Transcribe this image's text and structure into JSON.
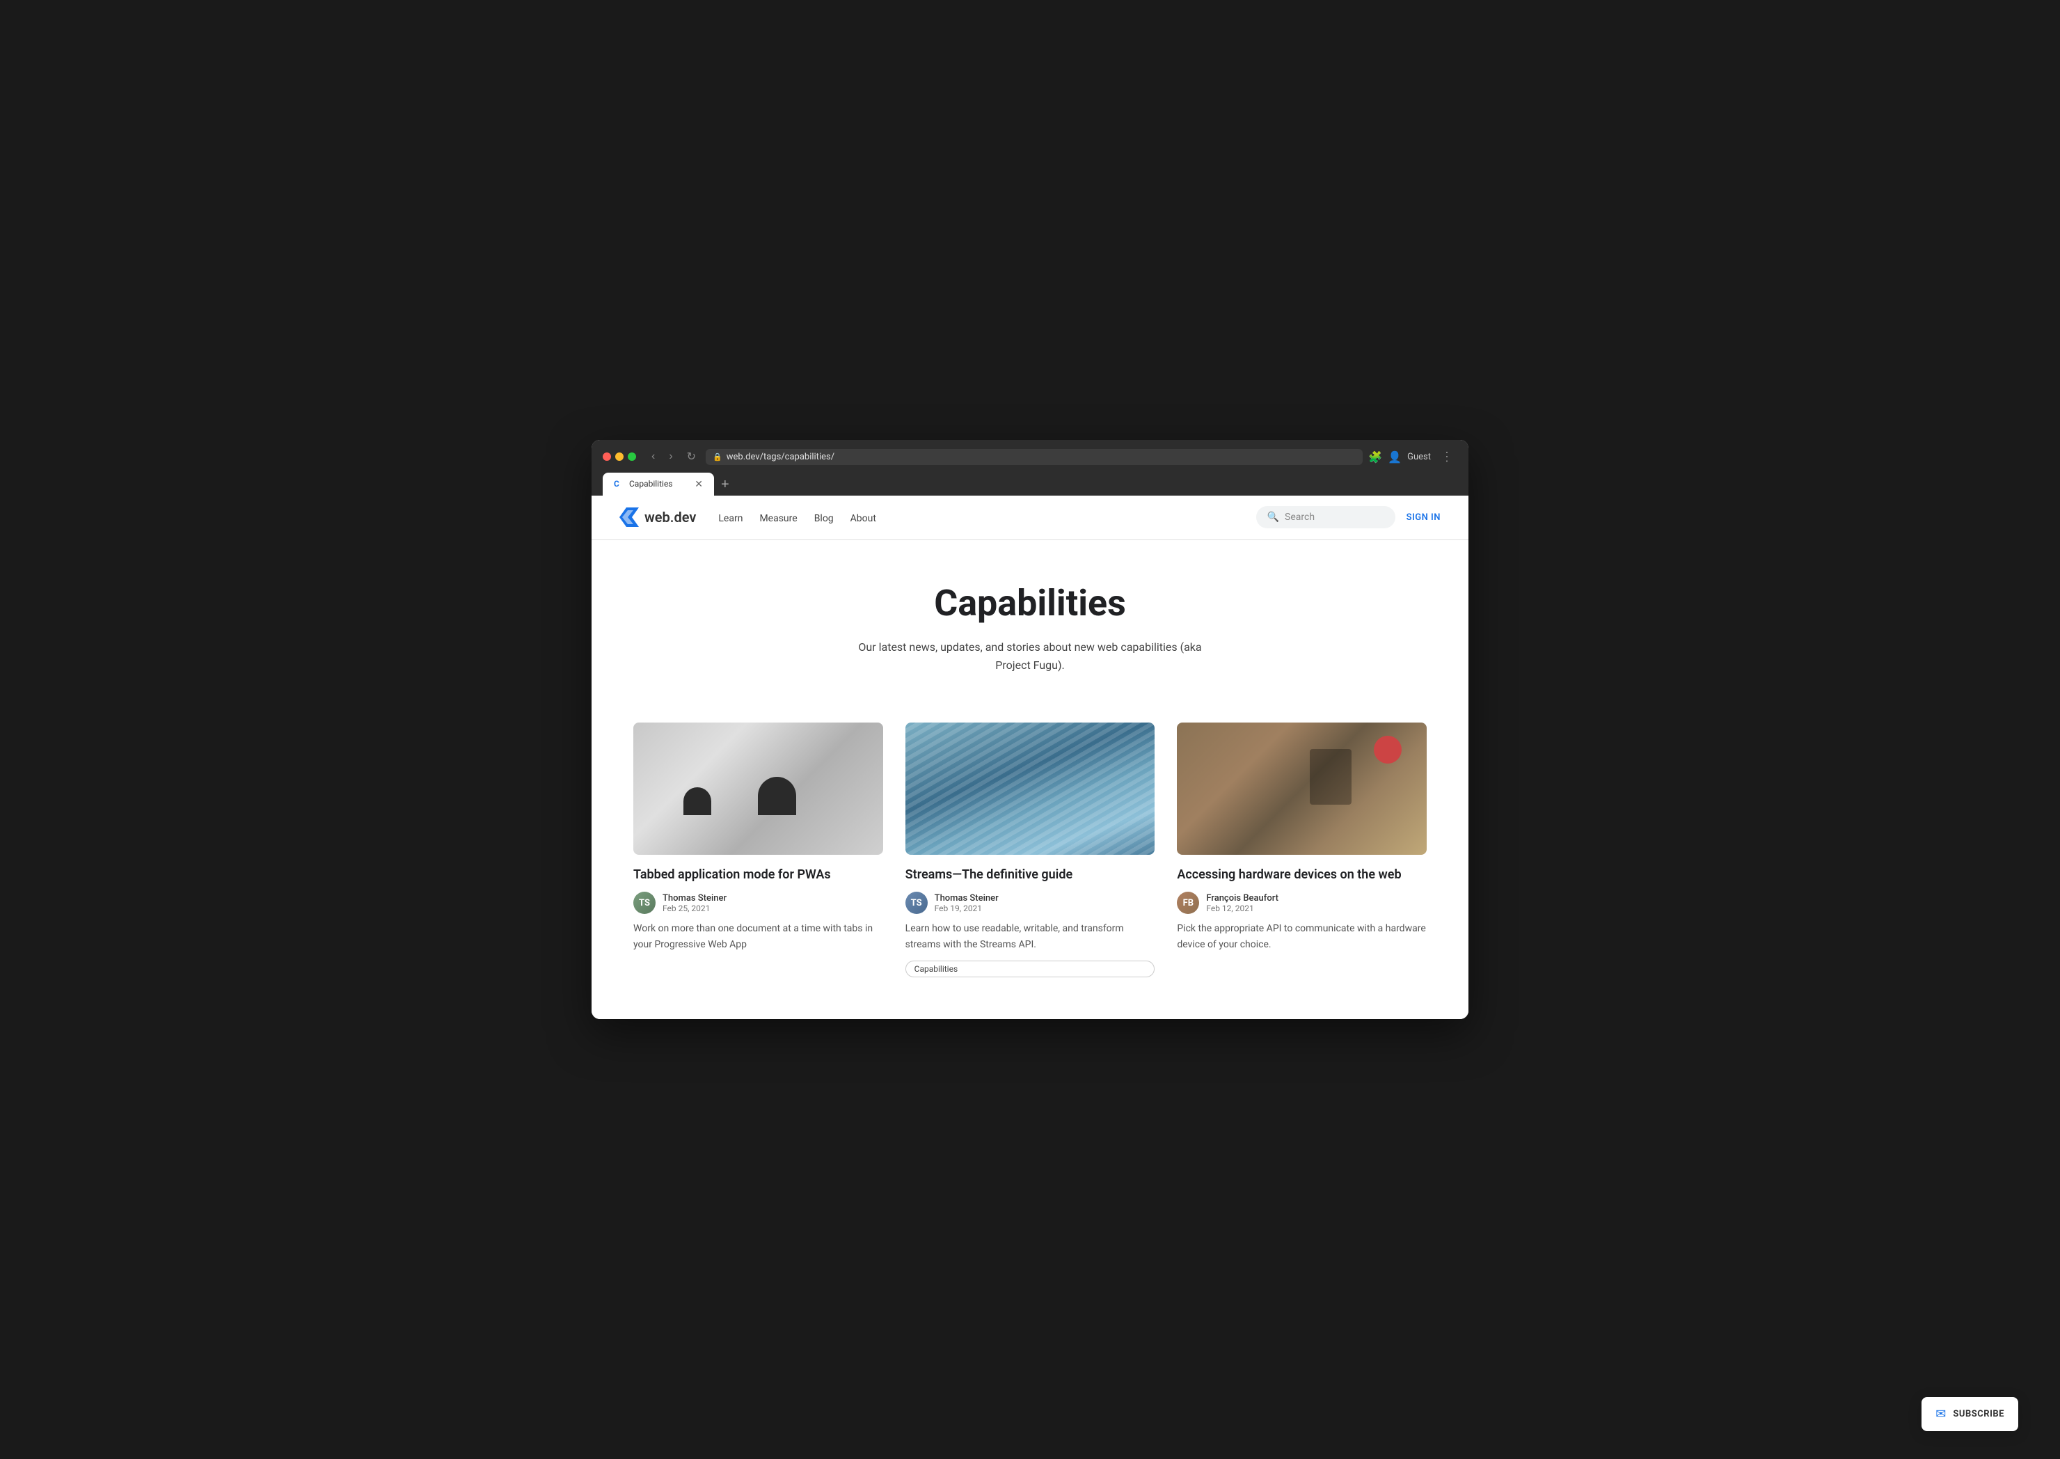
{
  "browser": {
    "tab_title": "Capabilities",
    "tab_favicon": "C",
    "address": "web.dev/tags/capabilities/",
    "nav_back": "‹",
    "nav_forward": "›",
    "nav_refresh": "↻",
    "new_tab": "+",
    "more_menu": "⋮",
    "extensions_label": "🧩",
    "user_label": "Guest"
  },
  "nav": {
    "logo_text": "web.dev",
    "links": [
      {
        "label": "Learn"
      },
      {
        "label": "Measure"
      },
      {
        "label": "Blog"
      },
      {
        "label": "About"
      }
    ],
    "search_placeholder": "Search",
    "sign_in": "SIGN IN"
  },
  "hero": {
    "title": "Capabilities",
    "subtitle": "Our latest news, updates, and stories about new web capabilities (aka Project Fugu)."
  },
  "articles": [
    {
      "title": "Tabbed application mode for PWAs",
      "author": "Thomas Steiner",
      "date": "Feb 25, 2021",
      "excerpt": "Work on more than one document at a time with tabs in your Progressive Web App",
      "tags": [],
      "image_type": "snowy"
    },
    {
      "title": "Streams—The definitive guide",
      "author": "Thomas Steiner",
      "date": "Feb 19, 2021",
      "excerpt": "Learn how to use readable, writable, and transform streams with the Streams API.",
      "tags": [
        "Capabilities"
      ],
      "image_type": "water"
    },
    {
      "title": "Accessing hardware devices on the web",
      "author": "François Beaufort",
      "date": "Feb 12, 2021",
      "excerpt": "Pick the appropriate API to communicate with a hardware device of your choice.",
      "tags": [],
      "image_type": "workshop"
    }
  ],
  "subscribe": {
    "label": "SUBSCRIBE",
    "icon": "✉"
  }
}
